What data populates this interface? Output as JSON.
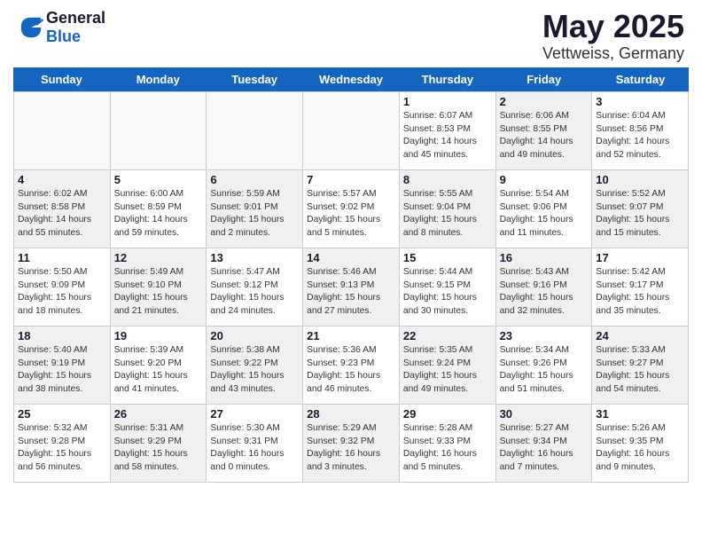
{
  "header": {
    "logo_general": "General",
    "logo_blue": "Blue",
    "title": "May 2025",
    "subtitle": "Vettweiss, Germany"
  },
  "days_of_week": [
    "Sunday",
    "Monday",
    "Tuesday",
    "Wednesday",
    "Thursday",
    "Friday",
    "Saturday"
  ],
  "weeks": [
    [
      {
        "day": "",
        "empty": true
      },
      {
        "day": "",
        "empty": true
      },
      {
        "day": "",
        "empty": true
      },
      {
        "day": "",
        "empty": true
      },
      {
        "day": "1",
        "sunrise": "6:07 AM",
        "sunset": "8:53 PM",
        "daylight": "14 hours and 45 minutes."
      },
      {
        "day": "2",
        "sunrise": "6:06 AM",
        "sunset": "8:55 PM",
        "daylight": "14 hours and 49 minutes."
      },
      {
        "day": "3",
        "sunrise": "6:04 AM",
        "sunset": "8:56 PM",
        "daylight": "14 hours and 52 minutes."
      }
    ],
    [
      {
        "day": "4",
        "sunrise": "6:02 AM",
        "sunset": "8:58 PM",
        "daylight": "14 hours and 55 minutes."
      },
      {
        "day": "5",
        "sunrise": "6:00 AM",
        "sunset": "8:59 PM",
        "daylight": "14 hours and 59 minutes."
      },
      {
        "day": "6",
        "sunrise": "5:59 AM",
        "sunset": "9:01 PM",
        "daylight": "15 hours and 2 minutes."
      },
      {
        "day": "7",
        "sunrise": "5:57 AM",
        "sunset": "9:02 PM",
        "daylight": "15 hours and 5 minutes."
      },
      {
        "day": "8",
        "sunrise": "5:55 AM",
        "sunset": "9:04 PM",
        "daylight": "15 hours and 8 minutes."
      },
      {
        "day": "9",
        "sunrise": "5:54 AM",
        "sunset": "9:06 PM",
        "daylight": "15 hours and 11 minutes."
      },
      {
        "day": "10",
        "sunrise": "5:52 AM",
        "sunset": "9:07 PM",
        "daylight": "15 hours and 15 minutes."
      }
    ],
    [
      {
        "day": "11",
        "sunrise": "5:50 AM",
        "sunset": "9:09 PM",
        "daylight": "15 hours and 18 minutes."
      },
      {
        "day": "12",
        "sunrise": "5:49 AM",
        "sunset": "9:10 PM",
        "daylight": "15 hours and 21 minutes."
      },
      {
        "day": "13",
        "sunrise": "5:47 AM",
        "sunset": "9:12 PM",
        "daylight": "15 hours and 24 minutes."
      },
      {
        "day": "14",
        "sunrise": "5:46 AM",
        "sunset": "9:13 PM",
        "daylight": "15 hours and 27 minutes."
      },
      {
        "day": "15",
        "sunrise": "5:44 AM",
        "sunset": "9:15 PM",
        "daylight": "15 hours and 30 minutes."
      },
      {
        "day": "16",
        "sunrise": "5:43 AM",
        "sunset": "9:16 PM",
        "daylight": "15 hours and 32 minutes."
      },
      {
        "day": "17",
        "sunrise": "5:42 AM",
        "sunset": "9:17 PM",
        "daylight": "15 hours and 35 minutes."
      }
    ],
    [
      {
        "day": "18",
        "sunrise": "5:40 AM",
        "sunset": "9:19 PM",
        "daylight": "15 hours and 38 minutes."
      },
      {
        "day": "19",
        "sunrise": "5:39 AM",
        "sunset": "9:20 PM",
        "daylight": "15 hours and 41 minutes."
      },
      {
        "day": "20",
        "sunrise": "5:38 AM",
        "sunset": "9:22 PM",
        "daylight": "15 hours and 43 minutes."
      },
      {
        "day": "21",
        "sunrise": "5:36 AM",
        "sunset": "9:23 PM",
        "daylight": "15 hours and 46 minutes."
      },
      {
        "day": "22",
        "sunrise": "5:35 AM",
        "sunset": "9:24 PM",
        "daylight": "15 hours and 49 minutes."
      },
      {
        "day": "23",
        "sunrise": "5:34 AM",
        "sunset": "9:26 PM",
        "daylight": "15 hours and 51 minutes."
      },
      {
        "day": "24",
        "sunrise": "5:33 AM",
        "sunset": "9:27 PM",
        "daylight": "15 hours and 54 minutes."
      }
    ],
    [
      {
        "day": "25",
        "sunrise": "5:32 AM",
        "sunset": "9:28 PM",
        "daylight": "15 hours and 56 minutes."
      },
      {
        "day": "26",
        "sunrise": "5:31 AM",
        "sunset": "9:29 PM",
        "daylight": "15 hours and 58 minutes."
      },
      {
        "day": "27",
        "sunrise": "5:30 AM",
        "sunset": "9:31 PM",
        "daylight": "16 hours and 0 minutes."
      },
      {
        "day": "28",
        "sunrise": "5:29 AM",
        "sunset": "9:32 PM",
        "daylight": "16 hours and 3 minutes."
      },
      {
        "day": "29",
        "sunrise": "5:28 AM",
        "sunset": "9:33 PM",
        "daylight": "16 hours and 5 minutes."
      },
      {
        "day": "30",
        "sunrise": "5:27 AM",
        "sunset": "9:34 PM",
        "daylight": "16 hours and 7 minutes."
      },
      {
        "day": "31",
        "sunrise": "5:26 AM",
        "sunset": "9:35 PM",
        "daylight": "16 hours and 9 minutes."
      }
    ]
  ]
}
